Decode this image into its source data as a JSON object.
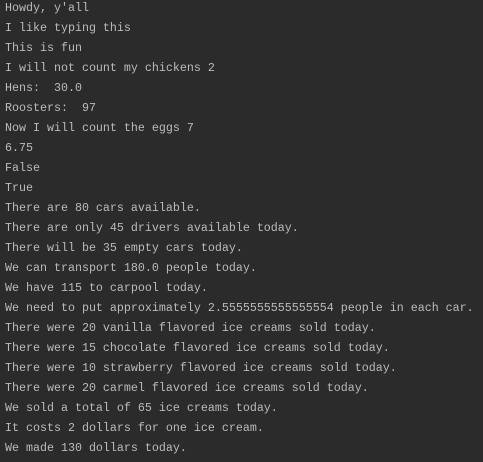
{
  "console": {
    "lines": [
      "Howdy, y'all",
      "I like typing this",
      "This is fun",
      "I will not count my chickens 2",
      "Hens:  30.0",
      "Roosters:  97",
      "Now I will count the eggs 7",
      "6.75",
      "False",
      "True",
      "There are 80 cars available.",
      "There are only 45 drivers available today.",
      "There will be 35 empty cars today.",
      "We can transport 180.0 people today.",
      "We have 115 to carpool today.",
      "We need to put approximately 2.5555555555555554 people in each car.",
      "There were 20 vanilla flavored ice creams sold today.",
      "There were 15 chocolate flavored ice creams sold today.",
      "There were 10 strawberry flavored ice creams sold today.",
      "There were 20 carmel flavored ice creams sold today.",
      "We sold a total of 65 ice creams today.",
      "It costs 2 dollars for one ice cream.",
      "We made 130 dollars today."
    ]
  },
  "colors": {
    "background": "#2b2b2b",
    "text": "#bbbbbb"
  }
}
